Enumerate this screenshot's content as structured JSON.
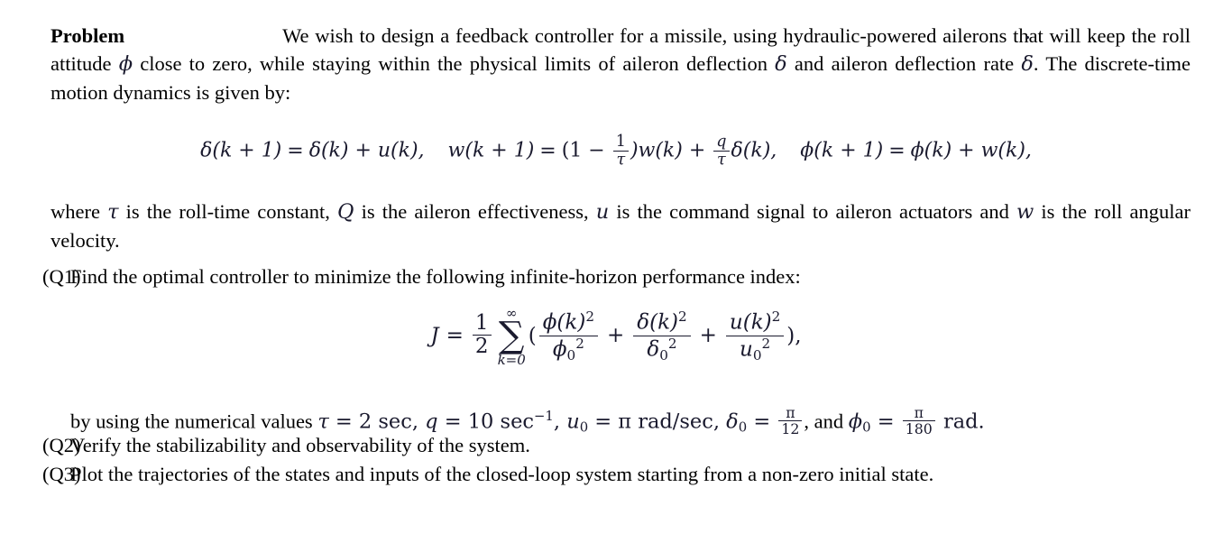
{
  "document": {
    "heading": "Problem",
    "intro": {
      "part1": "We wish to design a feedback controller for a missile, using hydraulic-powered ailerons that will keep the roll attitude ",
      "sym_phi": "ϕ",
      "part2": " close to zero, while staying within the physical limits of aileron deflection ",
      "sym_delta": "δ",
      "part3": " and aileron deflection rate ",
      "sym_deltadot": "δ",
      "part4": ". The discrete-time motion dynamics is given by:"
    },
    "equation_dynamics": {
      "eq_a_lhs": "δ(k + 1)",
      "eq_a_eq": "=",
      "eq_a_rhs": "δ(k) + u(k),",
      "eq_b_lhs": "w(k + 1)",
      "eq_b_eq": "=",
      "eq_b_open": "(1 − ",
      "eq_b_frac_num": "1",
      "eq_b_frac_den": "τ",
      "eq_b_mid": ")w(k) + ",
      "eq_b_frac2_num": "q",
      "eq_b_frac2_den": "τ",
      "eq_b_tail": "δ(k),",
      "eq_c_lhs": "ϕ(k + 1)",
      "eq_c_eq": "=",
      "eq_c_rhs": "ϕ(k) + w(k),"
    },
    "where_paragraph": {
      "p1": "where ",
      "s1": "τ",
      "p2": " is the roll-time constant, ",
      "s2": "Q",
      "p3": " is the aileron effectiveness, ",
      "s3": "u",
      "p4": " is the command signal to aileron actuators and ",
      "s4": "w",
      "p5": " is the roll angular velocity."
    },
    "questions": [
      {
        "label": "(Q1)",
        "text": "Find the optimal controller to minimize the following infinite-horizon performance index:"
      },
      {
        "label": "(Q2)",
        "text": "Verify the stabilizability and observability of the system."
      },
      {
        "label": "(Q3)",
        "text": "Plot the trajectories of the states and inputs of the closed-loop system starting from a non-zero initial state."
      }
    ],
    "equation_cost": {
      "J": "J",
      "equals": "=",
      "half_num": "1",
      "half_den": "2",
      "sum_symbol": "∑",
      "sum_upper": "∞",
      "sum_lower": "k=0",
      "open_paren": "(",
      "t1_num": "ϕ(k)",
      "t1_num_exp": "2",
      "t1_den": "ϕ",
      "t1_den_sub": "0",
      "t1_den_exp": "2",
      "plus1": "+",
      "t2_num": "δ(k)",
      "t2_num_exp": "2",
      "t2_den": "δ",
      "t2_den_sub": "0",
      "t2_den_exp": "2",
      "plus2": "+",
      "t3_num": "u(k)",
      "t3_num_exp": "2",
      "t3_den": "u",
      "t3_den_sub": "0",
      "t3_den_exp": "2",
      "close_paren": "),"
    },
    "numerical_values": {
      "prefix": "by using the numerical values ",
      "tau": "τ",
      "tau_eq": " = 2 sec, ",
      "q": "q",
      "q_eq": " = 10 sec",
      "q_exp": "−1",
      "q_tail": ", ",
      "u0": "u",
      "u0_sub": "0",
      "u0_eq": " = π rad/sec, ",
      "d0": "δ",
      "d0_sub": "0",
      "d0_eq": " = ",
      "d0_num": "π",
      "d0_den": "12",
      "d0_tail": ", and ",
      "p0": "ϕ",
      "p0_sub": "0",
      "p0_eq": " = ",
      "p0_num": "π",
      "p0_den": "180",
      "p0_tail": " rad."
    }
  },
  "colors": {
    "background": "#ffffff",
    "text": "#000000",
    "math": "#1a1a2e"
  }
}
